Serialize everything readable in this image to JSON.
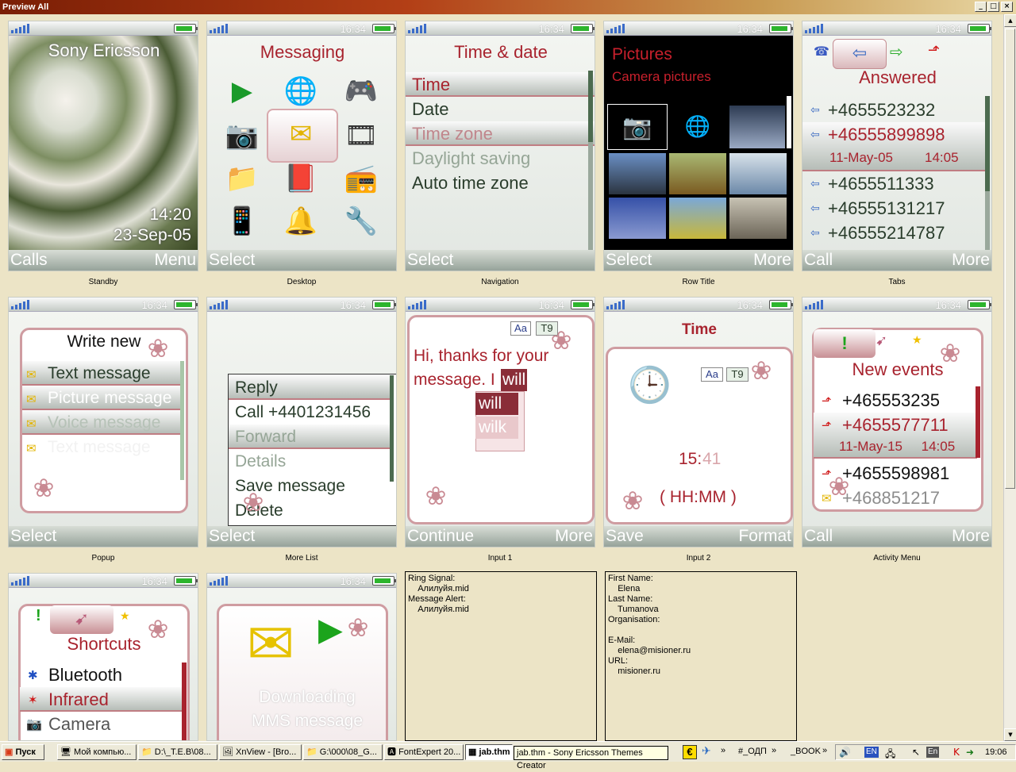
{
  "window": {
    "title": "Preview All",
    "controls": [
      "_",
      "□",
      "×"
    ]
  },
  "status": {
    "clock": "16:34"
  },
  "screens": {
    "standby": {
      "caption": "Standby",
      "brand": "Sony Ericsson",
      "time": "14:20",
      "date": "23-Sep-05",
      "soft_left": "Calls",
      "soft_right": "Menu"
    },
    "desktop": {
      "caption": "Desktop",
      "title": "Messaging",
      "soft_left": "Select"
    },
    "navigation": {
      "caption": "Navigation",
      "title": "Time & date",
      "items": [
        "Time",
        "Date",
        "Time zone",
        "Daylight saving",
        "Auto time zone"
      ],
      "soft_left": "Select"
    },
    "rowtitle": {
      "caption": "Row Title",
      "title": "Pictures",
      "subtitle": "Camera pictures",
      "soft_left": "Select",
      "soft_right": "More"
    },
    "tabs": {
      "caption": "Tabs",
      "title": "Answered",
      "numbers": [
        "+4655523232",
        "+46555899898",
        "+4655511333",
        "+46555131217",
        "+46555214787"
      ],
      "detail_date": "11-May-05",
      "detail_time": "14:05",
      "soft_left": "Call",
      "soft_right": "More"
    },
    "popup": {
      "caption": "Popup",
      "title": "Write new",
      "items": [
        "Text message",
        "Picture message",
        "Voice message",
        "Text message"
      ],
      "soft_left": "Select"
    },
    "morelist": {
      "caption": "More List",
      "items": [
        "Reply",
        "Call +4401231456",
        "Forward",
        "Details",
        "Save message",
        "Delete"
      ],
      "soft_left": "Select"
    },
    "input1": {
      "caption": "Input 1",
      "text1": "Hi, thanks for your",
      "text2": "message. I",
      "typed": "will",
      "suggest1": "will",
      "suggest2": "wilk",
      "btn_aa": "Aa",
      "btn_t9": "T9",
      "soft_left": "Continue",
      "soft_right": "More"
    },
    "input2": {
      "caption": "Input 2",
      "title": "Time",
      "time_h": "15:",
      "time_m": "41",
      "format": "( HH:MM )",
      "btn_aa": "Aa",
      "btn_t9": "T9",
      "soft_left": "Save",
      "soft_right": "Format"
    },
    "activity": {
      "caption": "Activity Menu",
      "title": "New events",
      "numbers": [
        "+465553235",
        "+4655577711",
        "+4655598981",
        "+468851217"
      ],
      "detail": "11-May-15     14:05",
      "soft_left": "Call",
      "soft_right": "More"
    },
    "shortcuts": {
      "title": "Shortcuts",
      "items": [
        "Bluetooth",
        "Infrared",
        "Camera"
      ]
    },
    "downloading": {
      "line1": "Downloading",
      "line2": "MMS message"
    }
  },
  "panels": {
    "sounds": "Ring Signal:\n    Алилуйя.mid\nMessage Alert:\n    Алилуйя.mid",
    "contact": "First Name:\n    Elena\nLast Name:\n    Tumanova\nOrganisation:\n\nE-Mail:\n    elena@misioner.ru\nURL:\n    misioner.ru"
  },
  "taskbar": {
    "start": "Пуск",
    "items": [
      "Мой компью...",
      "D:\\_T.E.B\\08...",
      "XnView - [Bro...",
      "G:\\000\\08_G...",
      "FontExpert 20...",
      "jab.thm"
    ],
    "tooltip": "jab.thm - Sony Ericsson Themes Creator",
    "tray1": "#_ОДП",
    "tray2": "_BOOK",
    "lang": "EN",
    "lang2": "En",
    "clock": "19:06"
  }
}
